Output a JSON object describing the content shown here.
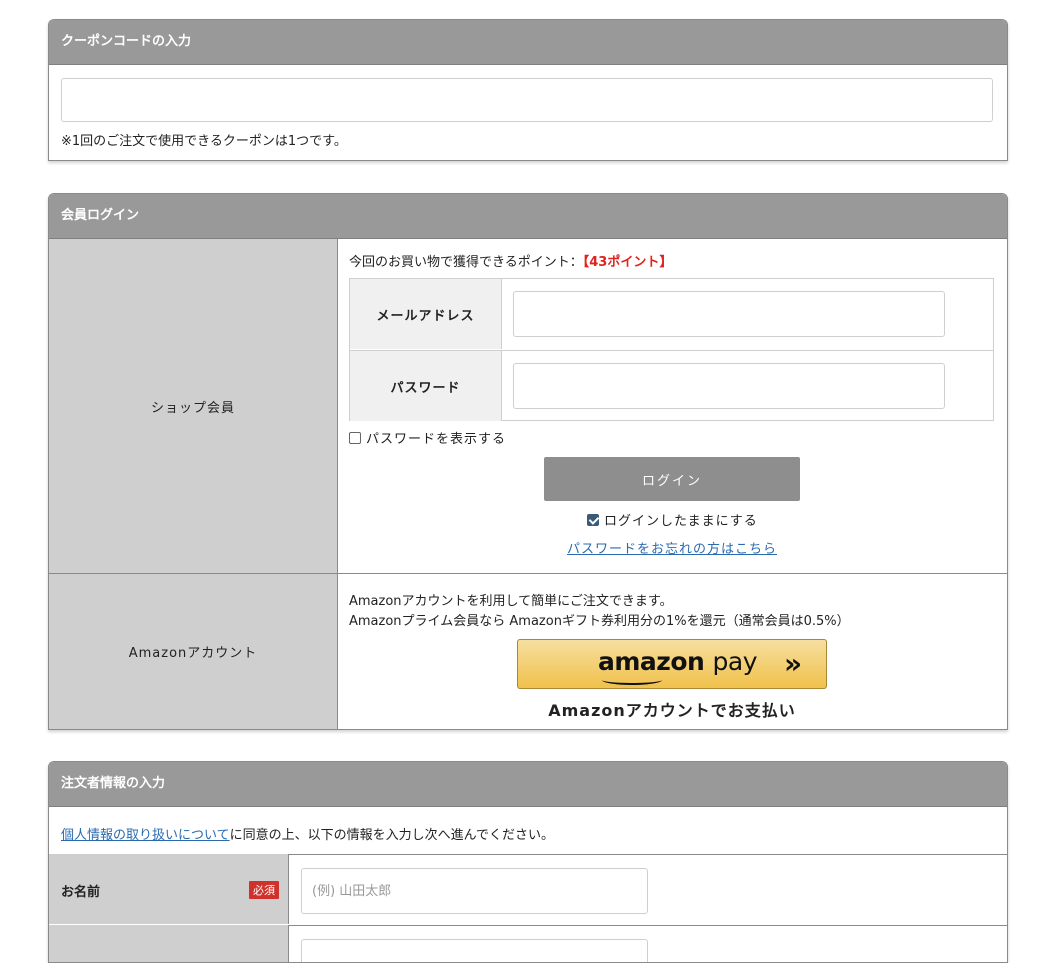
{
  "coupon": {
    "title": "クーポンコードの入力",
    "note": "※1回のご注文で使用できるクーポンは1つです。"
  },
  "login": {
    "title": "会員ログイン",
    "shop_member_label": "ショップ会員",
    "points_prefix": "今回のお買い物で獲得できるポイント：",
    "points_value": "【43ポイント】",
    "email_label": "メールアドレス",
    "password_label": "パスワード",
    "show_password_label": "パスワードを表示する",
    "show_password_checked": false,
    "login_button": "ログイン",
    "keep_login_label": "ログインしたままにする",
    "keep_login_checked": true,
    "forgot_link": "パスワードをお忘れの方はこちら",
    "amazon_label": "Amazonアカウント",
    "amazon_line1": "Amazonアカウントを利用して簡単にご注文できます。",
    "amazon_line2": "Amazonプライム会員なら Amazonギフト券利用分の1%を還元（通常会員は0.5%）",
    "amazon_logo_amazon": "amazon",
    "amazon_logo_pay": "pay",
    "amazon_caption": "Amazonアカウントでお支払い"
  },
  "orderer": {
    "title": "注文者情報の入力",
    "privacy_link": "個人情報の取り扱いについて",
    "agree_text": "に同意の上、以下の情報を入力し次へ進んでください。",
    "name_label": "お名前",
    "required_badge": "必須",
    "name_placeholder": "(例) 山田太郎"
  },
  "colors": {
    "header_bg": "#999999",
    "label_bg": "#cfcfcf",
    "points_red": "#e0231c",
    "link_blue": "#2a6bb0",
    "required_red": "#d0322b",
    "login_button_bg": "#8e8e8e"
  }
}
